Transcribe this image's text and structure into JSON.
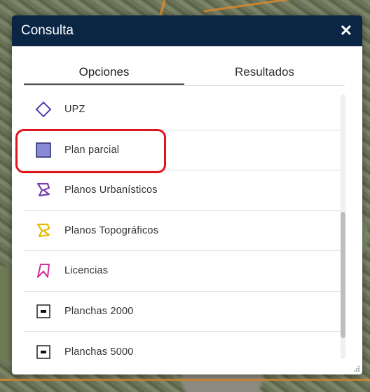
{
  "dialog": {
    "title": "Consulta",
    "close_label": "✕"
  },
  "tabs": [
    {
      "label": "Opciones",
      "active": true
    },
    {
      "label": "Resultados",
      "active": false
    }
  ],
  "items": [
    {
      "label": "UPZ",
      "icon": "upz-diamond-icon"
    },
    {
      "label": "Plan parcial",
      "icon": "plan-parcial-square-icon"
    },
    {
      "label": "Planos Urbanísticos",
      "icon": "planos-urbanisticos-polygon-icon"
    },
    {
      "label": "Planos Topográficos",
      "icon": "planos-topograficos-polygon-icon"
    },
    {
      "label": "Licencias",
      "icon": "licencias-polygon-icon"
    },
    {
      "label": "Planchas 2000",
      "icon": "planchas-2000-icon"
    },
    {
      "label": "Planchas 5000",
      "icon": "planchas-5000-icon"
    }
  ],
  "colors": {
    "header_bg": "#0b2545",
    "highlight": "#e0141b",
    "upz_stroke": "#3b2db0",
    "plan_parcial_fill": "#8a89d6",
    "urbanisticos_stroke": "#7a3fb0",
    "topograficos_stroke": "#e6b800",
    "licencias_stroke": "#d0309a"
  }
}
